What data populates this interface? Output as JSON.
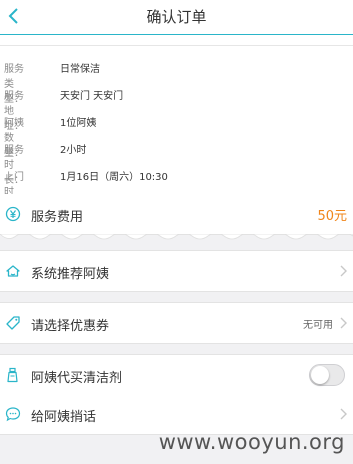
{
  "header": {
    "title": "确认订单"
  },
  "details": [
    {
      "key": "服务类型：",
      "value": "日常保洁"
    },
    {
      "key": "服务地址：",
      "value": "天安门 天安门"
    },
    {
      "key": "阿姨数量：",
      "value": "1位阿姨"
    },
    {
      "key": "服务时长：",
      "value": "2小时"
    },
    {
      "key": "上门时间：",
      "value": "1月16日（周六）10:30"
    }
  ],
  "fee": {
    "label": "服务费用",
    "price": "50元"
  },
  "recommend": {
    "label": "系统推荐阿姨"
  },
  "coupon": {
    "label": "请选择优惠券",
    "status": "无可用"
  },
  "cleaner": {
    "label": "阿姨代买清洁剂"
  },
  "message": {
    "label": "给阿姨捎话"
  },
  "watermark": "www.wooyun.org",
  "colors": {
    "accent": "#2ab5c9",
    "price": "#f08519"
  }
}
